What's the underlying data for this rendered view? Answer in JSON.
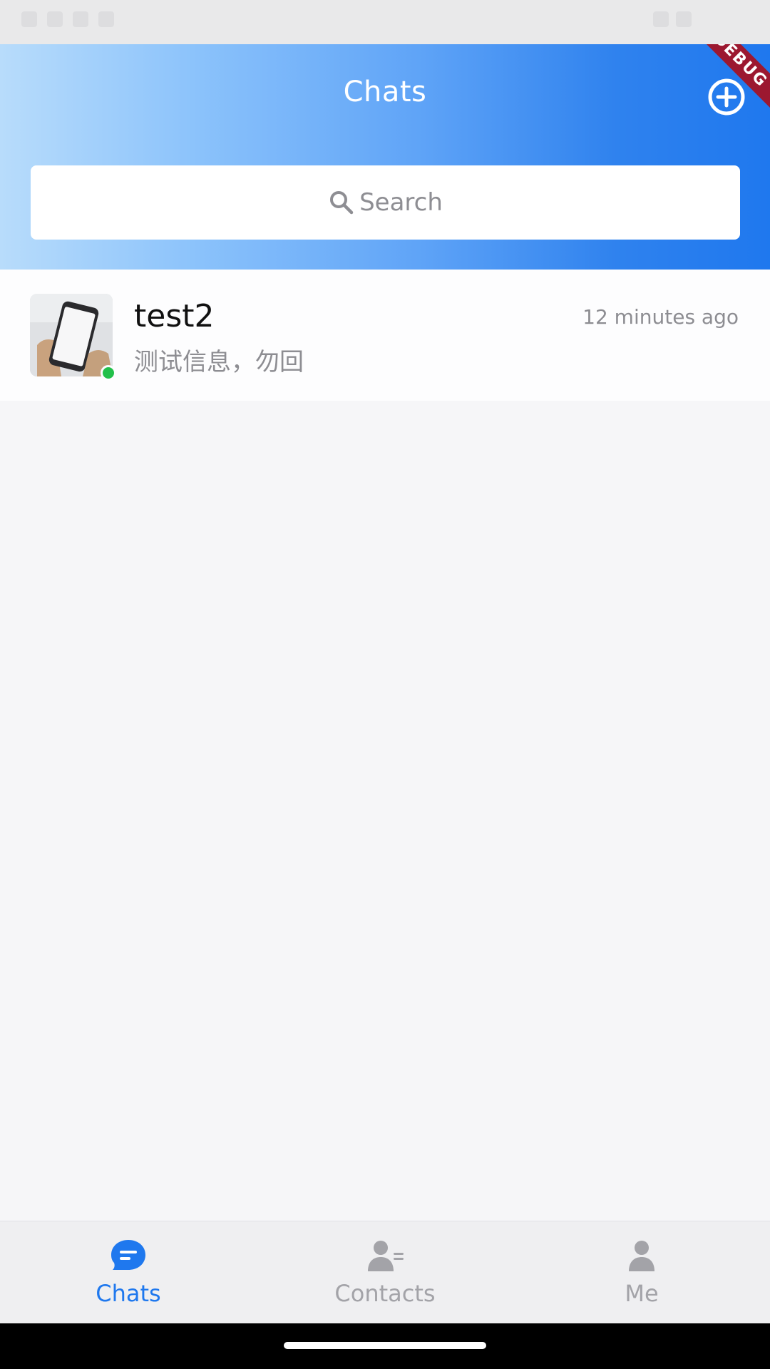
{
  "header": {
    "title": "Chats",
    "debug_banner": "DEBUG"
  },
  "search": {
    "label": "Search"
  },
  "chats": [
    {
      "name": "test2",
      "preview": "测试信息，勿回",
      "time": "12 minutes ago",
      "online": true
    }
  ],
  "bottom_nav": {
    "items": [
      {
        "label": "Chats",
        "icon": "chat-bubble-icon",
        "active": true
      },
      {
        "label": "Contacts",
        "icon": "contacts-icon",
        "active": false
      },
      {
        "label": "Me",
        "icon": "person-icon",
        "active": false
      }
    ]
  },
  "colors": {
    "accent": "#1f78ee",
    "online": "#22c04a",
    "inactive": "#a3a3a8"
  }
}
